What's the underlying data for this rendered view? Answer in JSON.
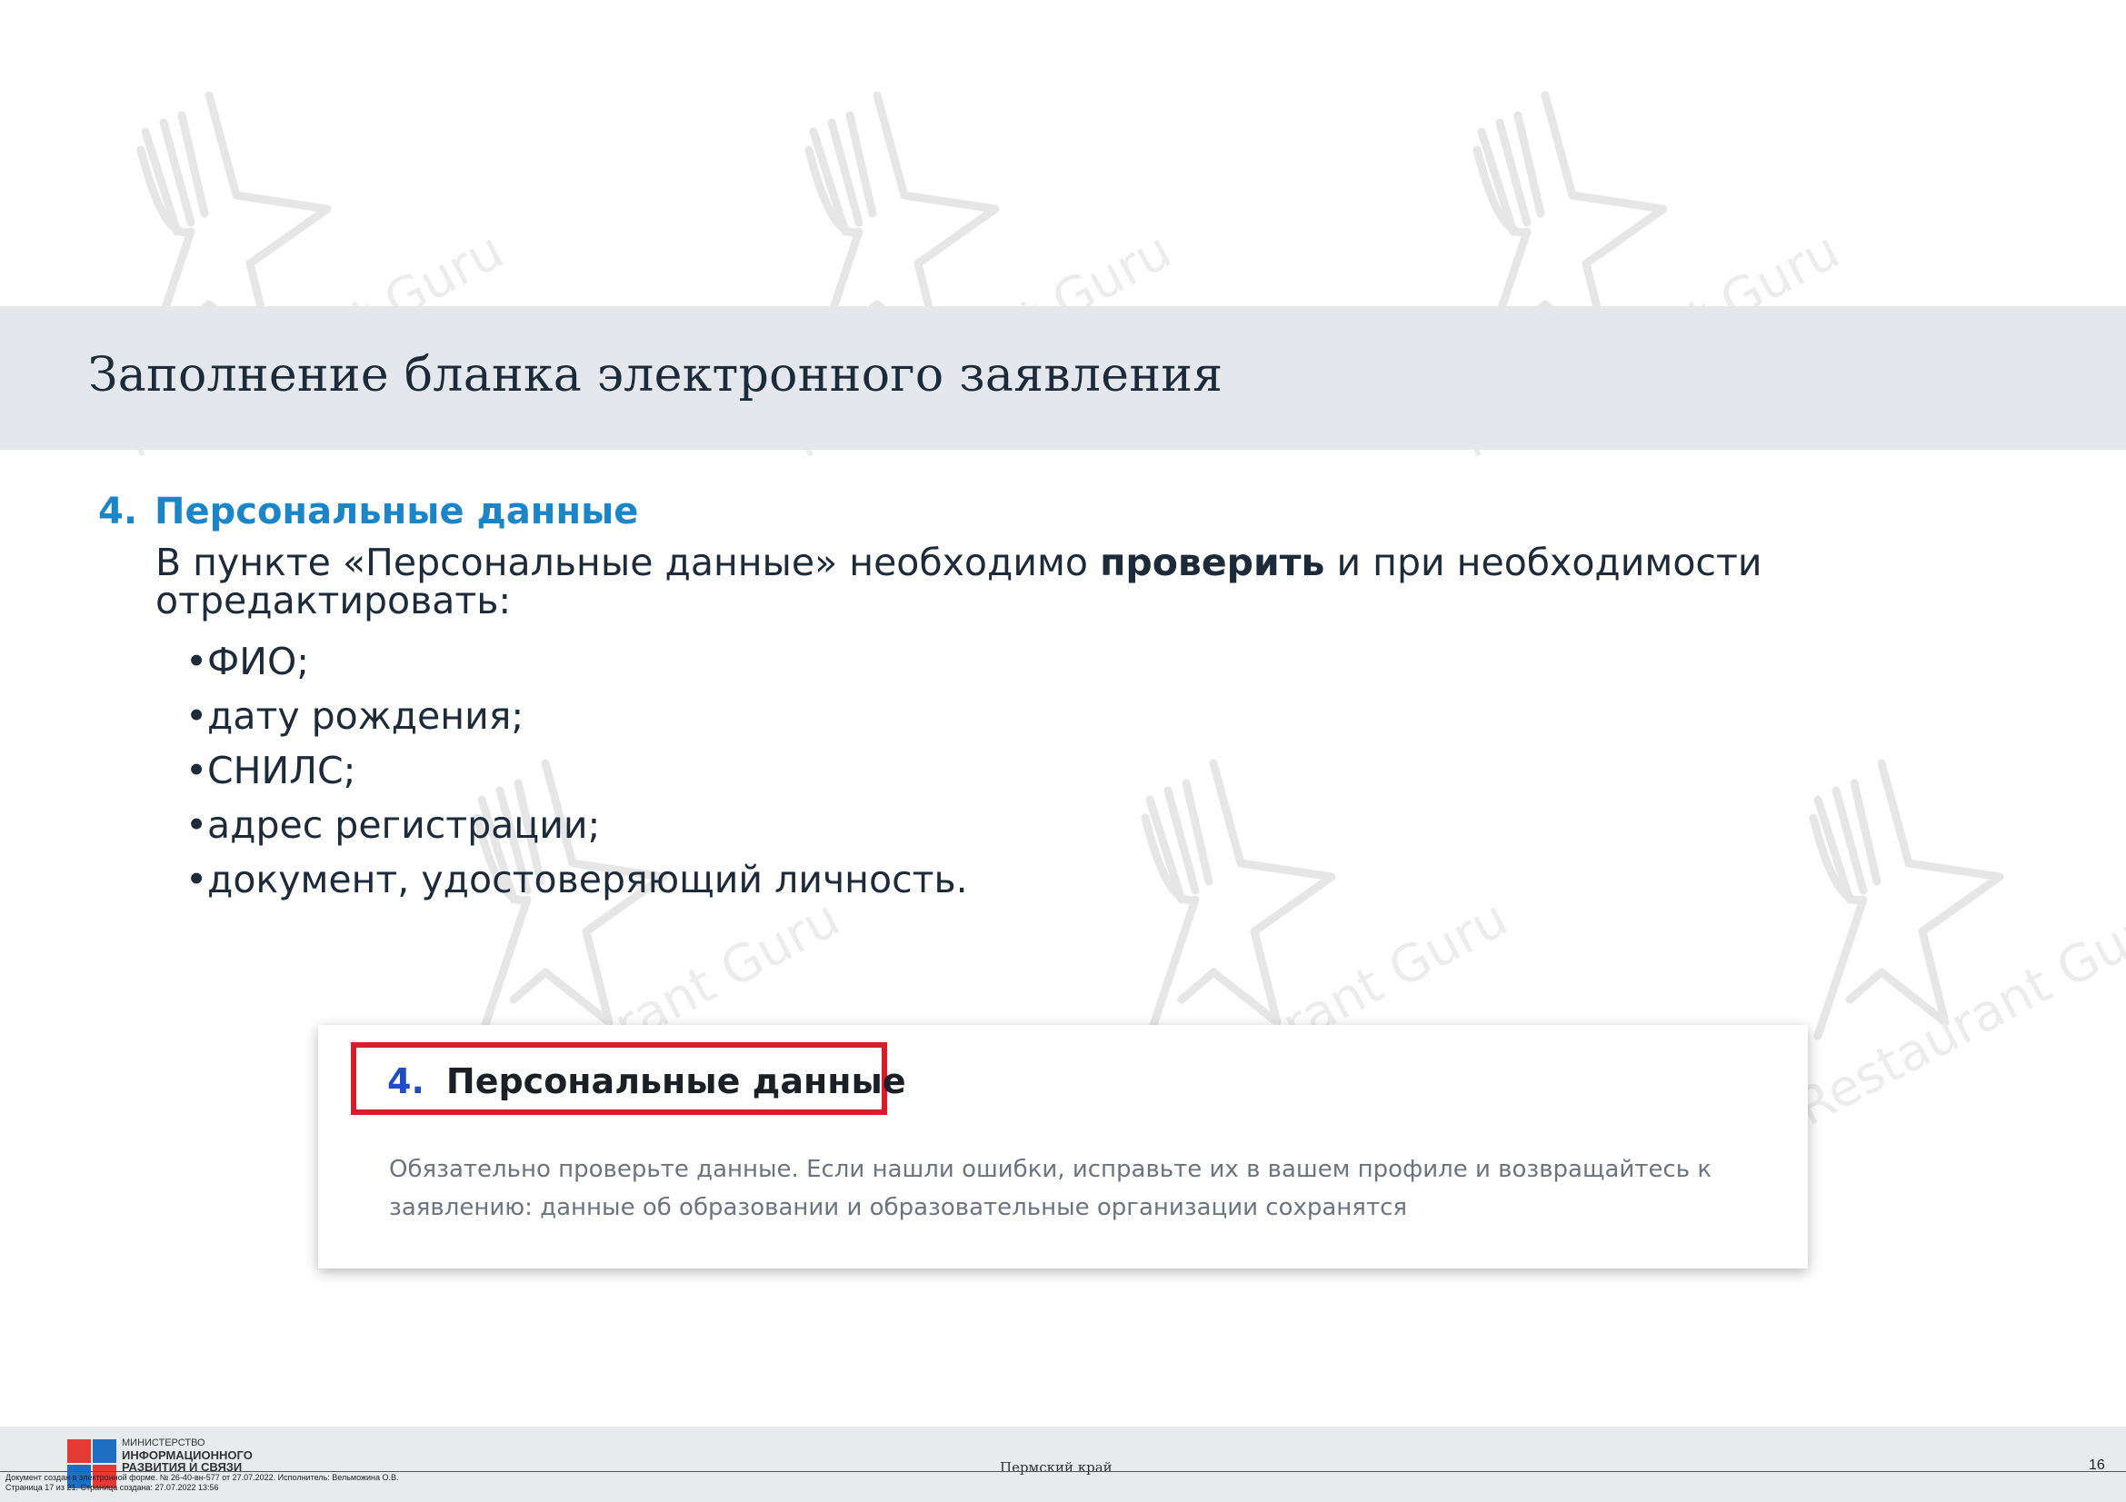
{
  "header": {
    "title": "Заполнение бланка электронного заявления"
  },
  "section": {
    "number": "4.",
    "heading": "Персональные данные",
    "intro_before": "В пункте «Персональные данные» необходимо ",
    "intro_bold": "проверить",
    "intro_after": " и при необходимости отредактировать:",
    "bullets": [
      "ФИО;",
      "дату рождения;",
      "СНИЛС;",
      "адрес регистрации;",
      "документ, удостоверяющий личность."
    ]
  },
  "screenshot": {
    "number": "4.",
    "heading": "Персональные данные",
    "text": "Обязательно проверьте данные. Если нашли ошибки, исправьте их в вашем профиле и возвращайтесь к заявлению: данные об образовании и образовательные организации сохранятся"
  },
  "footer": {
    "ministry_line1": "МИНИСТЕРСТВО",
    "ministry_line2": "ИНФОРМАЦИОННОГО",
    "ministry_line3": "РАЗВИТИЯ И СВЯЗИ",
    "region": "Пермский край",
    "page_number": "16",
    "doc_line1": "Документ создан в электронной форме. № 26-40-вн-577 от 27.07.2022. Исполнитель: Вельможина О.В.",
    "doc_line2": "Страница 17 из 21. Страница создана: 27.07.2022 13:56"
  },
  "watermark": {
    "text": "Restaurant Guru"
  },
  "colors": {
    "accent": "#1a86c8",
    "band": "#e4e8ec",
    "frame": "#d71c2a"
  }
}
